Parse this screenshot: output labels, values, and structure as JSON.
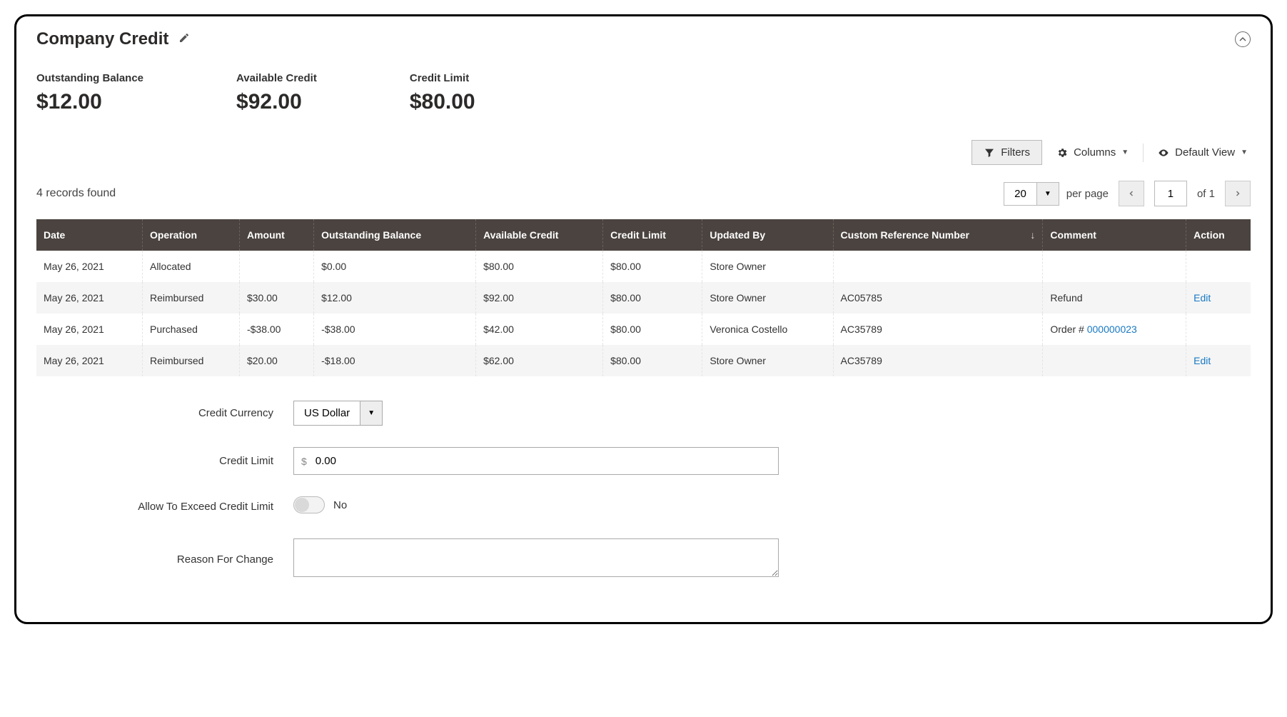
{
  "header": {
    "title": "Company Credit"
  },
  "summary": {
    "outstanding_balance_label": "Outstanding Balance",
    "outstanding_balance_value": "$12.00",
    "available_credit_label": "Available Credit",
    "available_credit_value": "$92.00",
    "credit_limit_label": "Credit Limit",
    "credit_limit_value": "$80.00"
  },
  "toolbar": {
    "filters_label": "Filters",
    "columns_label": "Columns",
    "default_view_label": "Default View"
  },
  "grid": {
    "records_found": "4 records found",
    "per_page_value": "20",
    "per_page_label": "per page",
    "page_value": "1",
    "page_of": "of 1",
    "columns": {
      "date": "Date",
      "operation": "Operation",
      "amount": "Amount",
      "outstanding_balance": "Outstanding Balance",
      "available_credit": "Available Credit",
      "credit_limit": "Credit Limit",
      "updated_by": "Updated By",
      "custom_reference": "Custom Reference Number",
      "comment": "Comment",
      "action": "Action"
    },
    "rows": [
      {
        "date": "May 26, 2021",
        "operation": "Allocated",
        "amount": "",
        "outstanding_balance": "$0.00",
        "available_credit": "$80.00",
        "credit_limit": "$80.00",
        "updated_by": "Store Owner",
        "custom_reference": "",
        "comment_text": "",
        "comment_link": "",
        "action": ""
      },
      {
        "date": "May 26, 2021",
        "operation": "Reimbursed",
        "amount": "$30.00",
        "outstanding_balance": "$12.00",
        "available_credit": "$92.00",
        "credit_limit": "$80.00",
        "updated_by": "Store Owner",
        "custom_reference": "AC05785",
        "comment_text": "Refund",
        "comment_link": "",
        "action": "Edit"
      },
      {
        "date": "May 26, 2021",
        "operation": "Purchased",
        "amount": "-$38.00",
        "outstanding_balance": "-$38.00",
        "available_credit": "$42.00",
        "credit_limit": "$80.00",
        "updated_by": "Veronica Costello",
        "custom_reference": "AC35789",
        "comment_text": "Order # ",
        "comment_link": "000000023",
        "action": ""
      },
      {
        "date": "May 26, 2021",
        "operation": "Reimbursed",
        "amount": "$20.00",
        "outstanding_balance": "-$18.00",
        "available_credit": "$62.00",
        "credit_limit": "$80.00",
        "updated_by": "Store Owner",
        "custom_reference": "AC35789",
        "comment_text": "",
        "comment_link": "",
        "action": "Edit"
      }
    ]
  },
  "form": {
    "credit_currency_label": "Credit Currency",
    "credit_currency_value": "US Dollar",
    "credit_limit_label": "Credit Limit",
    "credit_limit_prefix": "$",
    "credit_limit_value": "0.00",
    "allow_exceed_label": "Allow To Exceed Credit Limit",
    "allow_exceed_value": "No",
    "reason_label": "Reason For Change",
    "reason_value": ""
  }
}
